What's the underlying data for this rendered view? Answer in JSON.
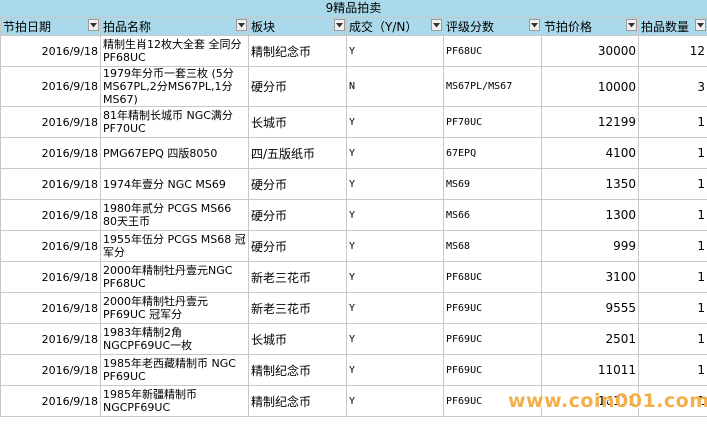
{
  "title": "9精品拍卖",
  "columns": [
    "节拍日期",
    "拍品名称",
    "板块",
    "成交（Y/N）",
    "评级分数",
    "节拍价格",
    "拍品数量"
  ],
  "rows": [
    {
      "date": "2016/9/18",
      "name": "精制生肖12枚大全套 全同分 PF68UC",
      "block": "精制纪念币",
      "deal": "Y",
      "grade": "PF68UC",
      "price": "30000",
      "qty": "12"
    },
    {
      "date": "2016/9/18",
      "name": "1979年分币一套三枚 (5分MS67PL,2分MS67PL,1分MS67)",
      "block": "硬分币",
      "deal": "N",
      "grade": "MS67PL/MS67",
      "price": "10000",
      "qty": "3"
    },
    {
      "date": "2016/9/18",
      "name": "81年精制长城币 NGC满分PF70UC",
      "block": "长城币",
      "deal": "Y",
      "grade": "PF70UC",
      "price": "12199",
      "qty": "1"
    },
    {
      "date": "2016/9/18",
      "name": "PMG67EPQ 四版8050",
      "block": "四/五版纸币",
      "deal": "Y",
      "grade": "67EPQ",
      "price": "4100",
      "qty": "1"
    },
    {
      "date": "2016/9/18",
      "name": "1974年壹分 NGC MS69",
      "block": "硬分币",
      "deal": "Y",
      "grade": "MS69",
      "price": "1350",
      "qty": "1"
    },
    {
      "date": "2016/9/18",
      "name": "1980年贰分 PCGS  MS66 80天王币",
      "block": "硬分币",
      "deal": "Y",
      "grade": "MS66",
      "price": "1300",
      "qty": "1"
    },
    {
      "date": "2016/9/18",
      "name": "1955年伍分 PCGS MS68 冠军分",
      "block": "硬分币",
      "deal": "Y",
      "grade": "MS68",
      "price": "999",
      "qty": "1"
    },
    {
      "date": "2016/9/18",
      "name": "2000年精制牡丹壹元NGC PF68UC",
      "block": "新老三花币",
      "deal": "Y",
      "grade": "PF68UC",
      "price": "3100",
      "qty": "1"
    },
    {
      "date": "2016/9/18",
      "name": "2000年精制牡丹壹元 PF69UC 冠军分",
      "block": "新老三花币",
      "deal": "Y",
      "grade": "PF69UC",
      "price": "9555",
      "qty": "1"
    },
    {
      "date": "2016/9/18",
      "name": "1983年精制2角NGCPF69UC一枚",
      "block": "长城币",
      "deal": "Y",
      "grade": "PF69UC",
      "price": "2501",
      "qty": "1"
    },
    {
      "date": "2016/9/18",
      "name": "1985年老西藏精制币 NGC PF69UC",
      "block": "精制纪念币",
      "deal": "Y",
      "grade": "PF69UC",
      "price": "11011",
      "qty": "1"
    },
    {
      "date": "2016/9/18",
      "name": "1985年新疆精制币 NGCPF69UC",
      "block": "精制纪念币",
      "deal": "Y",
      "grade": "PF69UC",
      "price": "16111",
      "qty": "1"
    }
  ],
  "watermark": "www.coin001.com",
  "colors": {
    "header": "#a9d9ea",
    "grid": "#c8c8c8",
    "watermark": "#f3b04a"
  },
  "icons": {
    "filter": "dropdown-arrow-icon"
  }
}
